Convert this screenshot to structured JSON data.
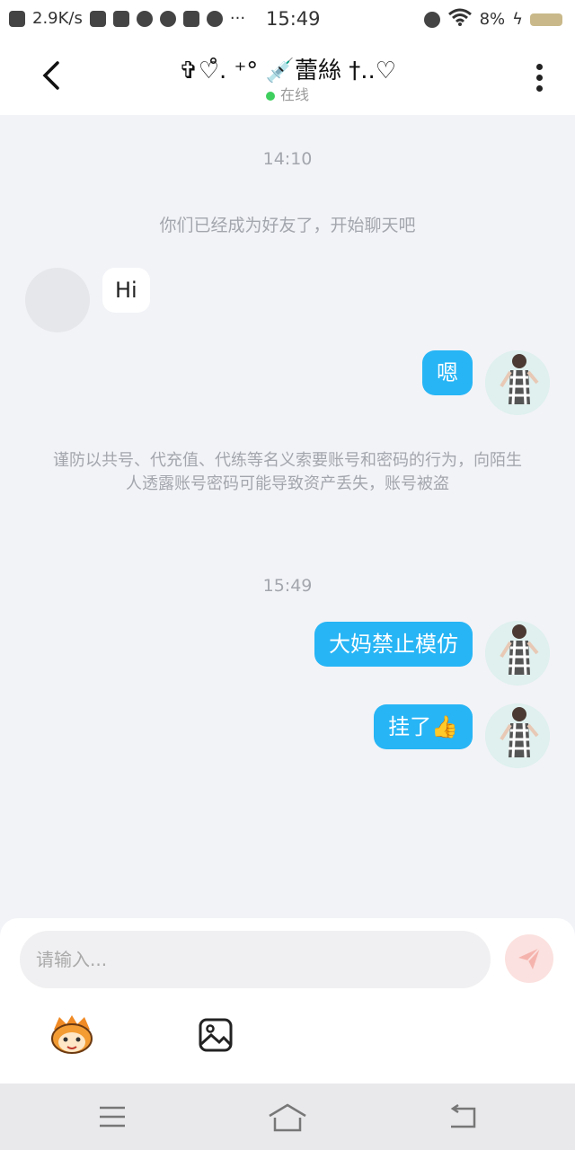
{
  "status_bar": {
    "net_speed": "2.9K/s",
    "time": "15:49",
    "battery": "8%"
  },
  "header": {
    "title": "✞♡̊. ⁺° 💉蕾絲 †..♡",
    "status": "在线"
  },
  "chat": {
    "time_1": "14:10",
    "system_1": "你们已经成为好友了，开始聊天吧",
    "msg_in_1": "Hi",
    "msg_out_1": "嗯",
    "notice": "谨防以共号、代充值、代练等名义索要账号和密码的行为，向陌生人透露账号密码可能导致资产丢失，账号被盗",
    "time_2": "15:49",
    "msg_out_2": "大妈禁止模仿",
    "msg_out_3": "挂了👍"
  },
  "input": {
    "placeholder": "请输入...",
    "value": ""
  },
  "icons": {
    "back": "chevron-left-icon",
    "more": "more-vertical-icon",
    "send": "send-icon",
    "emoji": "emoji-mascot-icon",
    "image": "image-icon"
  },
  "colors": {
    "bubble_out": "#27b5f5",
    "online_dot": "#3ecf5e",
    "send_bg": "#fbe1df"
  }
}
